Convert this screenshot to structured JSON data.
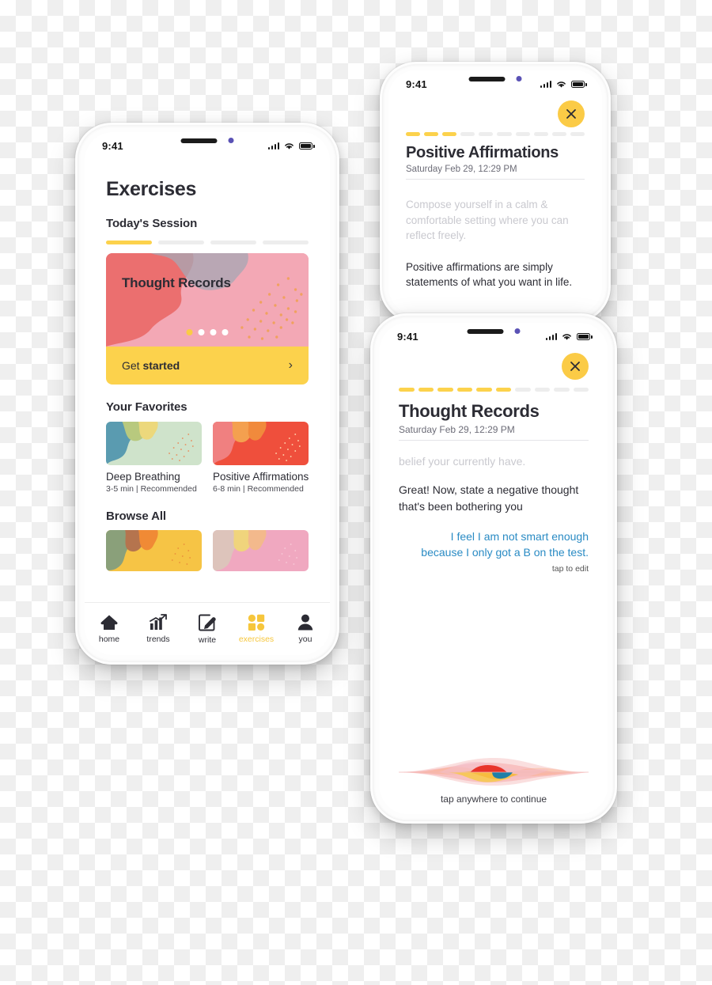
{
  "theme": {
    "accent_yellow": "#fcd24c",
    "accent_yellow_dark": "#fbcb46",
    "ink": "#2c2c34",
    "muted": "#6d6d78",
    "faded": "#c9c9cf",
    "link_blue": "#2a8bc4",
    "track_gray": "#ededed"
  },
  "phone1": {
    "status": {
      "time": "9:41",
      "signal_icon": "signal-bars-icon",
      "wifi_icon": "wifi-icon",
      "battery_icon": "battery-icon"
    },
    "page_title": "Exercises",
    "session": {
      "heading": "Today's Session",
      "segments_total": 4,
      "segments_done": 1
    },
    "hero": {
      "title": "Thought Records",
      "cta_prefix": "Get ",
      "cta_strong": "started",
      "chevron_icon": "chevron-right-icon",
      "carousel_total": 4,
      "carousel_active": 1
    },
    "favorites": {
      "heading": "Your Favorites",
      "items": [
        {
          "name": "Deep Breathing",
          "meta": "3-5 min | Recommended"
        },
        {
          "name": "Positive Affirmations",
          "meta": "6-8 min | Recommended"
        }
      ]
    },
    "browse": {
      "heading": "Browse All"
    },
    "tabs": [
      {
        "label": "home",
        "icon": "home-icon",
        "active": false
      },
      {
        "label": "trends",
        "icon": "trends-icon",
        "active": false
      },
      {
        "label": "write",
        "icon": "write-icon",
        "active": false
      },
      {
        "label": "exercises",
        "icon": "exercises-icon",
        "active": true
      },
      {
        "label": "you",
        "icon": "person-icon",
        "active": false
      }
    ]
  },
  "phone2": {
    "status": {
      "time": "9:41"
    },
    "close_icon": "close-x-icon",
    "progress": {
      "total": 10,
      "done": 3
    },
    "title": "Positive Affirmations",
    "date": "Saturday Feb 29, 12:29 PM",
    "faded_text": "Compose yourself in a calm & comfortable setting where you can reflect freely.",
    "prompt_text": "Positive affirmations are simply statements of what you want in life."
  },
  "phone3": {
    "status": {
      "time": "9:41"
    },
    "close_icon": "close-x-icon",
    "progress": {
      "total": 10,
      "done": 6
    },
    "title": "Thought Records",
    "date": "Saturday Feb 29, 12:29 PM",
    "faded_text": "belief your currently have.",
    "prompt_text": "Great! Now, state a negative thought that's been bothering you",
    "answer_text": "I feel I am not smart enough because I only got a B on the test.",
    "tap_to_edit": "tap to edit",
    "waveform_icon": "siri-waveform-icon",
    "tap_continue": "tap anywhere to continue"
  }
}
